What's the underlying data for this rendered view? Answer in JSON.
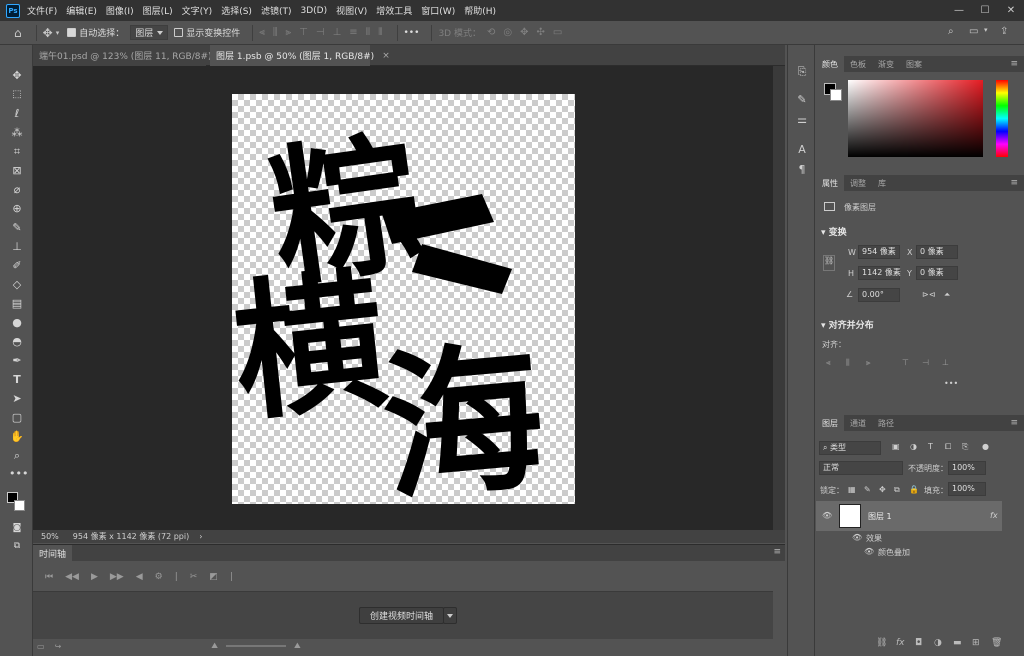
{
  "app": {
    "logo": "Ps"
  },
  "menu": [
    "文件(F)",
    "编辑(E)",
    "图像(I)",
    "图层(L)",
    "文字(Y)",
    "选择(S)",
    "滤镜(T)",
    "3D(D)",
    "视图(V)",
    "增效工具",
    "窗口(W)",
    "帮助(H)"
  ],
  "window_controls": {
    "minimize": "—",
    "maximize": "☐",
    "close": "✕"
  },
  "options": {
    "auto_select_label": "自动选择：",
    "auto_select_target": "图层",
    "show_transform_label": "显示变换控件",
    "more": "•••",
    "mode3d_label": "3D 模式："
  },
  "tabs": [
    {
      "label": "端午01.psd @ 123% (图层 11, RGB/8#) *",
      "close": "×"
    },
    {
      "label": "图层 1.psb @ 50% (图层 1, RGB/8#)",
      "close": "×"
    }
  ],
  "status": {
    "zoom": "50%",
    "doc_info": "954 像素 x 1142 像素 (72 ppi)",
    "arrow": "›"
  },
  "timeline": {
    "tab": "时间轴",
    "create_button": "创建视频时间轴"
  },
  "color_panel": {
    "tabs": [
      "颜色",
      "色板",
      "渐变",
      "图案"
    ],
    "foreground": "#000000",
    "background": "#ffffff"
  },
  "properties": {
    "tabs": [
      "属性",
      "调整",
      "库"
    ],
    "type_label": "像素图层",
    "transform_title": "变换",
    "w_label": "W",
    "w_value": "954 像素",
    "h_label": "H",
    "h_value": "1142 像素",
    "x_label": "X",
    "x_value": "0 像素",
    "y_label": "Y",
    "y_value": "0 像素",
    "angle_value": "0.00°",
    "align_title": "对齐并分布",
    "align_label": "对齐：",
    "more": "•••"
  },
  "layers": {
    "tabs": [
      "图层",
      "通道",
      "路径"
    ],
    "filter_label": "类型",
    "blend_mode": "正常",
    "opacity_label": "不透明度：",
    "opacity_value": "100%",
    "lock_label": "锁定：",
    "fill_label": "填充：",
    "fill_value": "100%",
    "layer_name": "图层 1",
    "fx": "fx",
    "effects_label": "效果",
    "effect_item": "颜色叠加"
  },
  "artwork_text": "粽横海"
}
